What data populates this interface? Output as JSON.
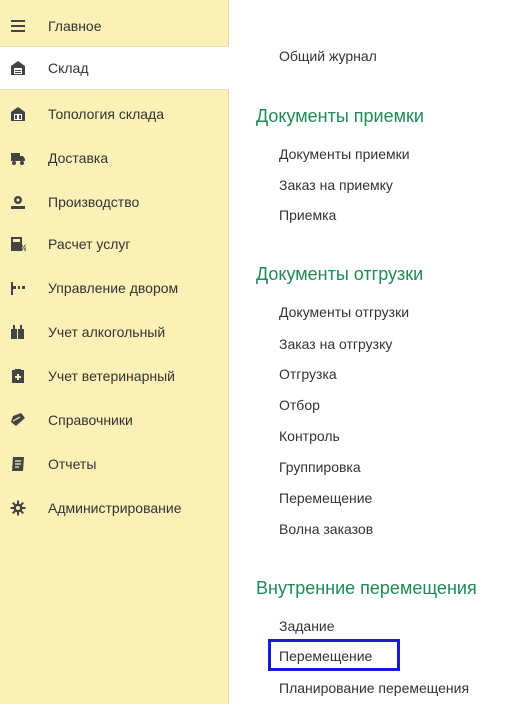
{
  "sidebar": {
    "items": [
      {
        "label": "Главное",
        "icon": "hamburger-icon"
      },
      {
        "label": "Склад",
        "icon": "warehouse-icon"
      },
      {
        "label": "Топология склада",
        "icon": "warehouse-topology-icon"
      },
      {
        "label": "Доставка",
        "icon": "delivery-icon"
      },
      {
        "label": "Производство",
        "icon": "production-icon"
      },
      {
        "label": "Расчет услуг",
        "icon": "calculator-icon"
      },
      {
        "label": "Управление двором",
        "icon": "barrier-icon"
      },
      {
        "label": "Учет алкогольный",
        "icon": "bottles-icon"
      },
      {
        "label": "Учет ветеринарный",
        "icon": "vet-icon"
      },
      {
        "label": "Справочники",
        "icon": "book-icon"
      },
      {
        "label": "Отчеты",
        "icon": "report-icon"
      },
      {
        "label": "Администрирование",
        "icon": "gear-icon"
      }
    ],
    "selected": "Склад"
  },
  "main": {
    "top_link": "Общий журнал",
    "sections": [
      {
        "title": "Документы приемки",
        "links": [
          "Документы приемки",
          "Заказ на приемку",
          "Приемка"
        ]
      },
      {
        "title": "Документы отгрузки",
        "links": [
          "Документы отгрузки",
          "Заказ на отгрузку",
          "Отгрузка",
          "Отбор",
          "Контроль",
          "Группировка",
          "Перемещение",
          "Волна заказов"
        ]
      },
      {
        "title": "Внутренние перемещения",
        "links": [
          "Задание",
          "Перемещение",
          "Планирование перемещения"
        ]
      }
    ],
    "highlighted_link": "Перемещение"
  },
  "colors": {
    "sidebar_bg": "#fbf0b5",
    "section_title": "#1f8a55",
    "highlight_border": "#1a1ad6"
  }
}
